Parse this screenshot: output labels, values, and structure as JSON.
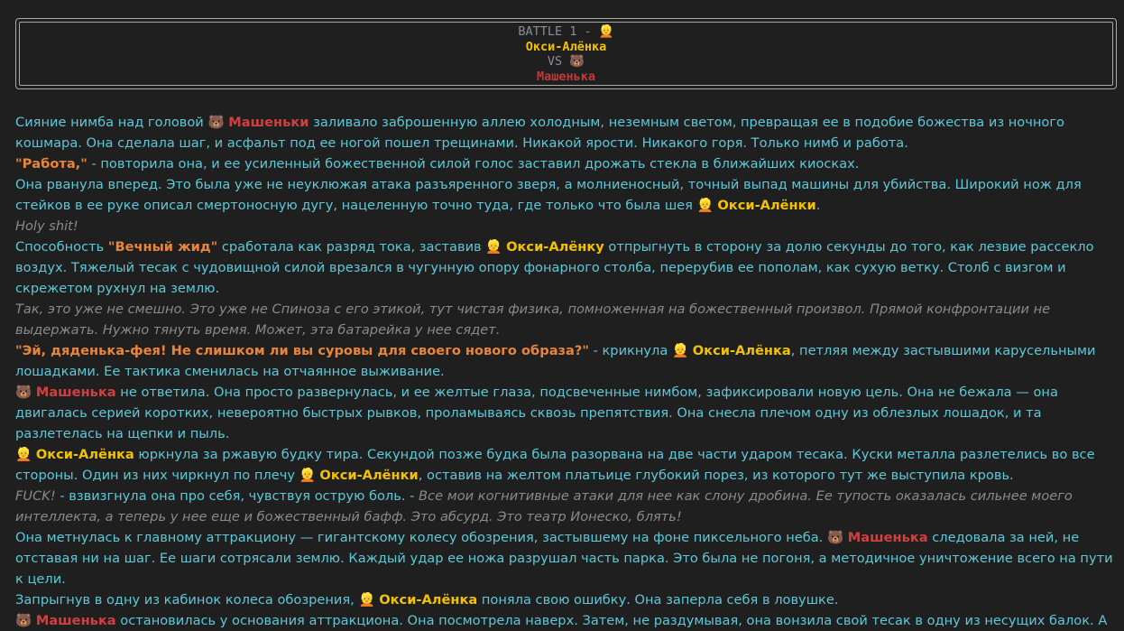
{
  "header": {
    "battle_label": "BATTLE 1 - ",
    "fighter_one_emoji": "👱",
    "fighter_one": "Окси-Алёнка",
    "vs_label": "VS ",
    "fighter_two_emoji": "🐻",
    "fighter_two": "Машенька"
  },
  "colors": {
    "background": "#1f1f1f",
    "narration": "#5ec8d8",
    "thought": "#8a8a8a",
    "speech": "#e8853a",
    "fighter_one": "#f2c200",
    "fighter_two": "#d04040"
  },
  "names": {
    "o": "Окси-Алёнка",
    "o_acc": "Окси-Алёнку",
    "o_gen": "Окси-Алёнки",
    "m": "Машенька",
    "m_gen": "Машеньки",
    "o_emoji": "👱",
    "m_emoji": "🐻"
  },
  "story": {
    "p1_a": "Сияние нимба над головой ",
    "p1_b": " заливало заброшенную аллею холодным, неземным светом, превращая ее в подобие божества из ночного кошмара. Она сделала шаг, и асфальт под ее ногой пошел трещинами. Никакой ярости. Никакого горя. Только нимб и работа.",
    "p2_speech": "\"Работа,\"",
    "p2_b": " - повторила она, и ее усиленный божественной силой голос заставил дрожать стекла в ближайших киосках.",
    "p3_a": "Она рванула вперед. Это была уже не неуклюжая атака разъяренного зверя, а молниеносный, точный выпад машины для убийства. Широкий нож для стейков в ее руке описал смертоносную дугу, нацеленную точно туда, где только что была шея ",
    "p3_b": ".",
    "p4_think": "Holy shit!",
    "p5_a": "Способность ",
    "p5_speech": "\"Вечный жид\"",
    "p5_b": " сработала как разряд тока, заставив ",
    "p5_c": " отпрыгнуть в сторону за долю секунды до того, как лезвие рассекло воздух. Тяжелый тесак с чудовищной силой врезался в чугунную опору фонарного столба, перерубив ее пополам, как сухую ветку. Столб с визгом и скрежетом рухнул на землю.",
    "p6_think": "Так, это уже не смешно. Это уже не Спиноза с его этикой, тут чистая физика, помноженная на божественный произвол. Прямой конфронтации не выдержать. Нужно тянуть время. Может, эта батарейка у нее сядет.",
    "p7_speech": "\"Эй, дяденька-фея! Не слишком ли вы суровы для своего нового образа?\"",
    "p7_b": " - крикнула ",
    "p7_c": ", петляя между застывшими карусельными лошадками. Ее тактика сменилась на отчаянное выживание.",
    "p8_b": " не ответила. Она просто развернулась, и ее желтые глаза, подсвеченные нимбом, зафиксировали новую цель. Она не бежала — она двигалась серией коротких, невероятно быстрых рывков, проламываясь сквозь препятствия. Она снесла плечом одну из облезлых лошадок, и та разлетелась на щепки и пыль.",
    "p9_b": " юркнула за ржавую будку тира. Секундой позже будка была разорвана на две части ударом тесака. Куски металла разлетелись во все стороны. Один из них чиркнул по плечу ",
    "p9_c": ", оставив на желтом платьице глубокий порез, из которого тут же выступила кровь.",
    "p10_think_a": "FUCK!",
    "p10_b": " - взвизгнула она про себя, чувствуя острую боль. - ",
    "p10_think_b": "Все мои когнитивные атаки для нее как слону дробина. Ее тупость оказалась сильнее моего интеллекта, а теперь у нее еще и божественный бафф. Это абсурд. Это театр Ионеско, блять!",
    "p11_a": "Она метнулась к главному аттракциону — гигантскому колесу обозрения, застывшему на фоне пиксельного неба. ",
    "p11_b": " следовала за ней, не отставая ни на шаг. Ее шаги сотрясали землю. Каждый удар ее ножа разрушал часть парка. Это была не погоня, а методичное уничтожение всего на пути к цели.",
    "p12_a": "Запрыгнув в одну из кабинок колеса обозрения, ",
    "p12_b": " поняла свою ошибку. Она заперла себя в ловушке.",
    "p13_b": " остановилась у основания аттракциона. Она посмотрела наверх. Затем, не раздумывая, она вонзила свой тесак в одну из несущих балок. А"
  }
}
